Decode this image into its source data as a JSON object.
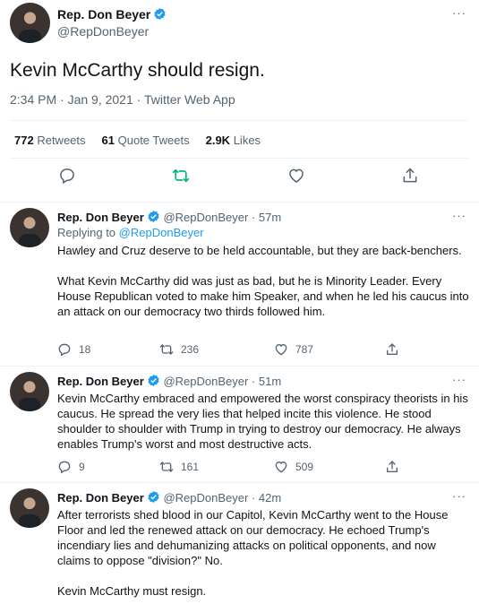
{
  "main_tweet": {
    "name": "Rep. Don Beyer",
    "handle": "@RepDonBeyer",
    "text": "Kevin McCarthy should resign.",
    "meta": "2:34 PM · Jan 9, 2021 · Twitter Web App",
    "stats": {
      "retweets_count": "772",
      "retweets_label": "Retweets",
      "quotes_count": "61",
      "quotes_label": "Quote Tweets",
      "likes_count": "2.9K",
      "likes_label": "Likes"
    },
    "more_label": "···"
  },
  "replies": [
    {
      "name": "Rep. Don Beyer",
      "handle": "@RepDonBeyer",
      "time": "· 57m",
      "replying_prefix": "Replying to",
      "replying_to": "@RepDonBeyer",
      "text": "Hawley and Cruz deserve to be held accountable, but they are back-benchers.\n\nWhat Kevin McCarthy did was just as bad, but he is Minority Leader. Every House Republican voted to make him Speaker, and when he led his caucus into an attack on our democracy two thirds followed him.",
      "replies_count": "18",
      "retweets_count": "236",
      "likes_count": "787",
      "more_label": "···"
    },
    {
      "name": "Rep. Don Beyer",
      "handle": "@RepDonBeyer",
      "time": "· 51m",
      "text": "Kevin McCarthy embraced and empowered the worst conspiracy theorists in his caucus. He spread the very lies that helped incite this violence. He stood shoulder to shoulder with Trump in trying to destroy our democracy. He always enables Trump's worst and most destructive acts.",
      "replies_count": "9",
      "retweets_count": "161",
      "likes_count": "509",
      "more_label": "···"
    },
    {
      "name": "Rep. Don Beyer",
      "handle": "@RepDonBeyer",
      "time": "· 42m",
      "text": "After terrorists shed blood in our Capitol, Kevin McCarthy went to the House Floor and led the renewed attack on our democracy. He echoed Trump's incendiary lies and dehumanizing attacks on political opponents, and now claims to oppose \"division?\" No.\n\nKevin McCarthy must resign.",
      "more_label": "···"
    }
  ],
  "colors": {
    "accent": "#1d9bf0",
    "retweet_green": "#00ba7c",
    "text": "#0f1419",
    "secondary": "#536471",
    "border": "#eff3f4"
  }
}
